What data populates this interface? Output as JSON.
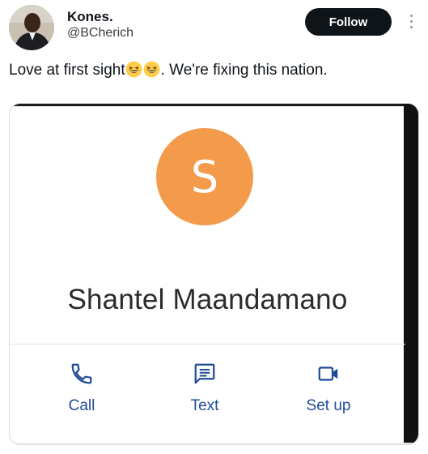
{
  "tweet": {
    "author_name": "Kones.",
    "author_handle": "@BCherich",
    "follow_label": "Follow",
    "text_before": "Love at first sight",
    "text_after": ". We're fixing this nation."
  },
  "contact_card": {
    "initial": "S",
    "avatar_color": "#f39a4b",
    "name": "Shantel Maandamano",
    "actions": [
      {
        "label": "Call",
        "icon": "phone-icon"
      },
      {
        "label": "Text",
        "icon": "message-icon"
      },
      {
        "label": "Set up",
        "icon": "video-icon"
      }
    ],
    "accent_color": "#1f4b96"
  }
}
